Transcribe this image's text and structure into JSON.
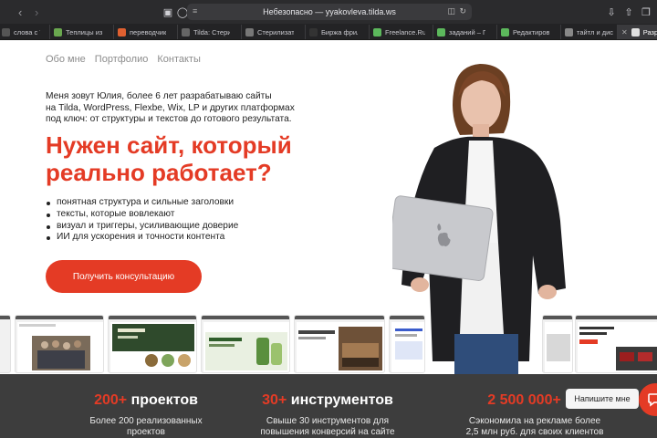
{
  "browser": {
    "url": "Небезопасно — yyakovleva.tilda.ws",
    "tabs": [
      {
        "label": "слова с ТТ в…",
        "fav": "#555555"
      },
      {
        "label": "Теплицы из…",
        "fav": "#6aa84f"
      },
      {
        "label": "переводчик…",
        "fav": "#e06030"
      },
      {
        "label": "Tilda: Стери…",
        "fav": "#666666"
      },
      {
        "label": "Стерилизато…",
        "fav": "#777777"
      },
      {
        "label": "Биржа фрил…",
        "fav": "#333333"
      },
      {
        "label": "Freelance.Ru",
        "fav": "#5cb85c"
      },
      {
        "label": "заданий – П…",
        "fav": "#5cb85c"
      },
      {
        "label": "Редактирова…",
        "fav": "#5cb85c"
      },
      {
        "label": "тайтл и диск…",
        "fav": "#888888"
      },
      {
        "label": "Разрабо",
        "fav": "#e0e0e0"
      }
    ]
  },
  "nav": {
    "about": "Обо мне",
    "portfolio": "Портфолио",
    "contacts": "Контакты"
  },
  "hero": {
    "intro_line1": "Меня зовут Юлия, более 6 лет разрабатываю сайты",
    "intro_line2": "на Tilda, WordPress, Flexbe, Wix, LP и других платформах",
    "intro_line3": "под ключ: от структуры и текстов до готового результата.",
    "headline_line1": "Нужен сайт, который",
    "headline_line2": "реально работает?",
    "bullets": [
      "понятная структура и сильные заголовки",
      "тексты, которые вовлекают",
      "визуал и триггеры, усиливающие доверие",
      "ИИ для ускорения и точности контента"
    ],
    "cta": "Получить консультацию"
  },
  "stats": [
    {
      "num": "200+",
      "word": " проектов",
      "desc1": "Более 200 реализованных",
      "desc2": "проектов"
    },
    {
      "num": "30+",
      "word": " инструментов",
      "desc1": "Свыше 30 инструментов для",
      "desc2": "повышения конверсий на сайте"
    },
    {
      "num": "2 500 000+",
      "word": " ру",
      "desc1": "Сэкономила на рекламе более",
      "desc2": "2,5 млн руб. для своих клиентов"
    }
  ],
  "chat": {
    "label": "Напишите мне"
  },
  "colors": {
    "accent": "#e43b25",
    "stats_bg": "#3d3d3d"
  }
}
